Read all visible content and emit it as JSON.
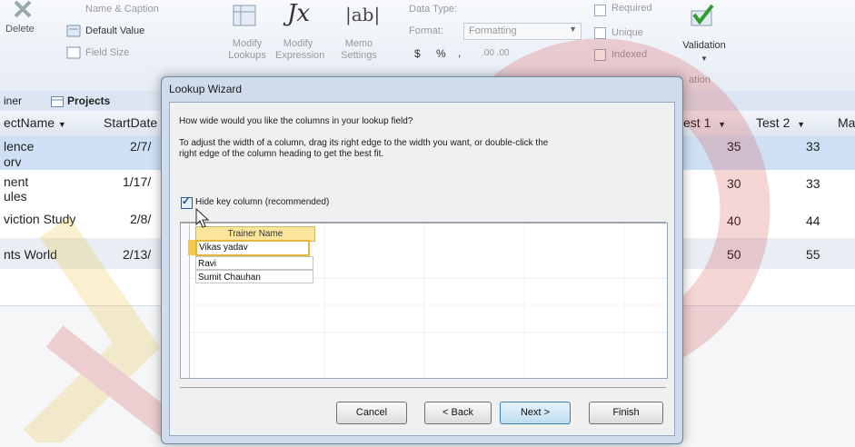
{
  "ribbon": {
    "delete_label": "Delete",
    "name_caption_label": "Name & Caption",
    "default_value_label": "Default Value",
    "field_size_label": "Field Size",
    "modify_lookups_label": "Modify Lookups",
    "modify_expression_label": "Modify Expression",
    "memo_settings_label": "Memo Settings",
    "data_type_label": "Data Type:",
    "format_label": "Format:",
    "format_value": "Formatting",
    "currency_symbol": "$",
    "percent_symbol": "%",
    "comma_symbol": ",",
    "inc_dec_label": ".00 .00",
    "required_label": "Required",
    "unique_label": "Unique",
    "indexed_label": "Indexed",
    "validation_label": "Validation",
    "group_label": "ation"
  },
  "tabs": [
    {
      "label": "iner"
    },
    {
      "label": "Projects"
    }
  ],
  "table": {
    "headers": {
      "project_name": "ectName",
      "start_date": "StartDate",
      "test1": "est 1",
      "test2": "Test 2",
      "extra": "Ma"
    },
    "rows": [
      {
        "name_line1": "lence",
        "name_line2": "orv",
        "start": "2/7/",
        "test1": "35",
        "test2": "33"
      },
      {
        "name_line1": "nent",
        "name_line2": "ules",
        "start": "1/17/",
        "test1": "30",
        "test2": "33"
      },
      {
        "name_line1": "viction Study",
        "name_line2": "",
        "start": "2/8/",
        "test1": "40",
        "test2": "44"
      },
      {
        "name_line1": "nts World",
        "name_line2": "",
        "start": "2/13/",
        "test1": "50",
        "test2": "55"
      }
    ]
  },
  "dialog": {
    "title": "Lookup Wizard",
    "question": "How wide would you like the columns in your lookup field?",
    "instruction_line1": "To adjust the width of a column, drag its right edge to the width you want, or double-click the",
    "instruction_line2": "right edge of the column heading to get the best fit.",
    "hide_key_label": "Hide key column (recommended)",
    "hide_key_checked": true,
    "column_header": "Trainer Name",
    "values": [
      "Vikas yadav",
      "Ravi",
      "Sumit Chauhan"
    ],
    "buttons": {
      "cancel": "Cancel",
      "back": "< Back",
      "next": "Next >",
      "finish": "Finish"
    }
  }
}
